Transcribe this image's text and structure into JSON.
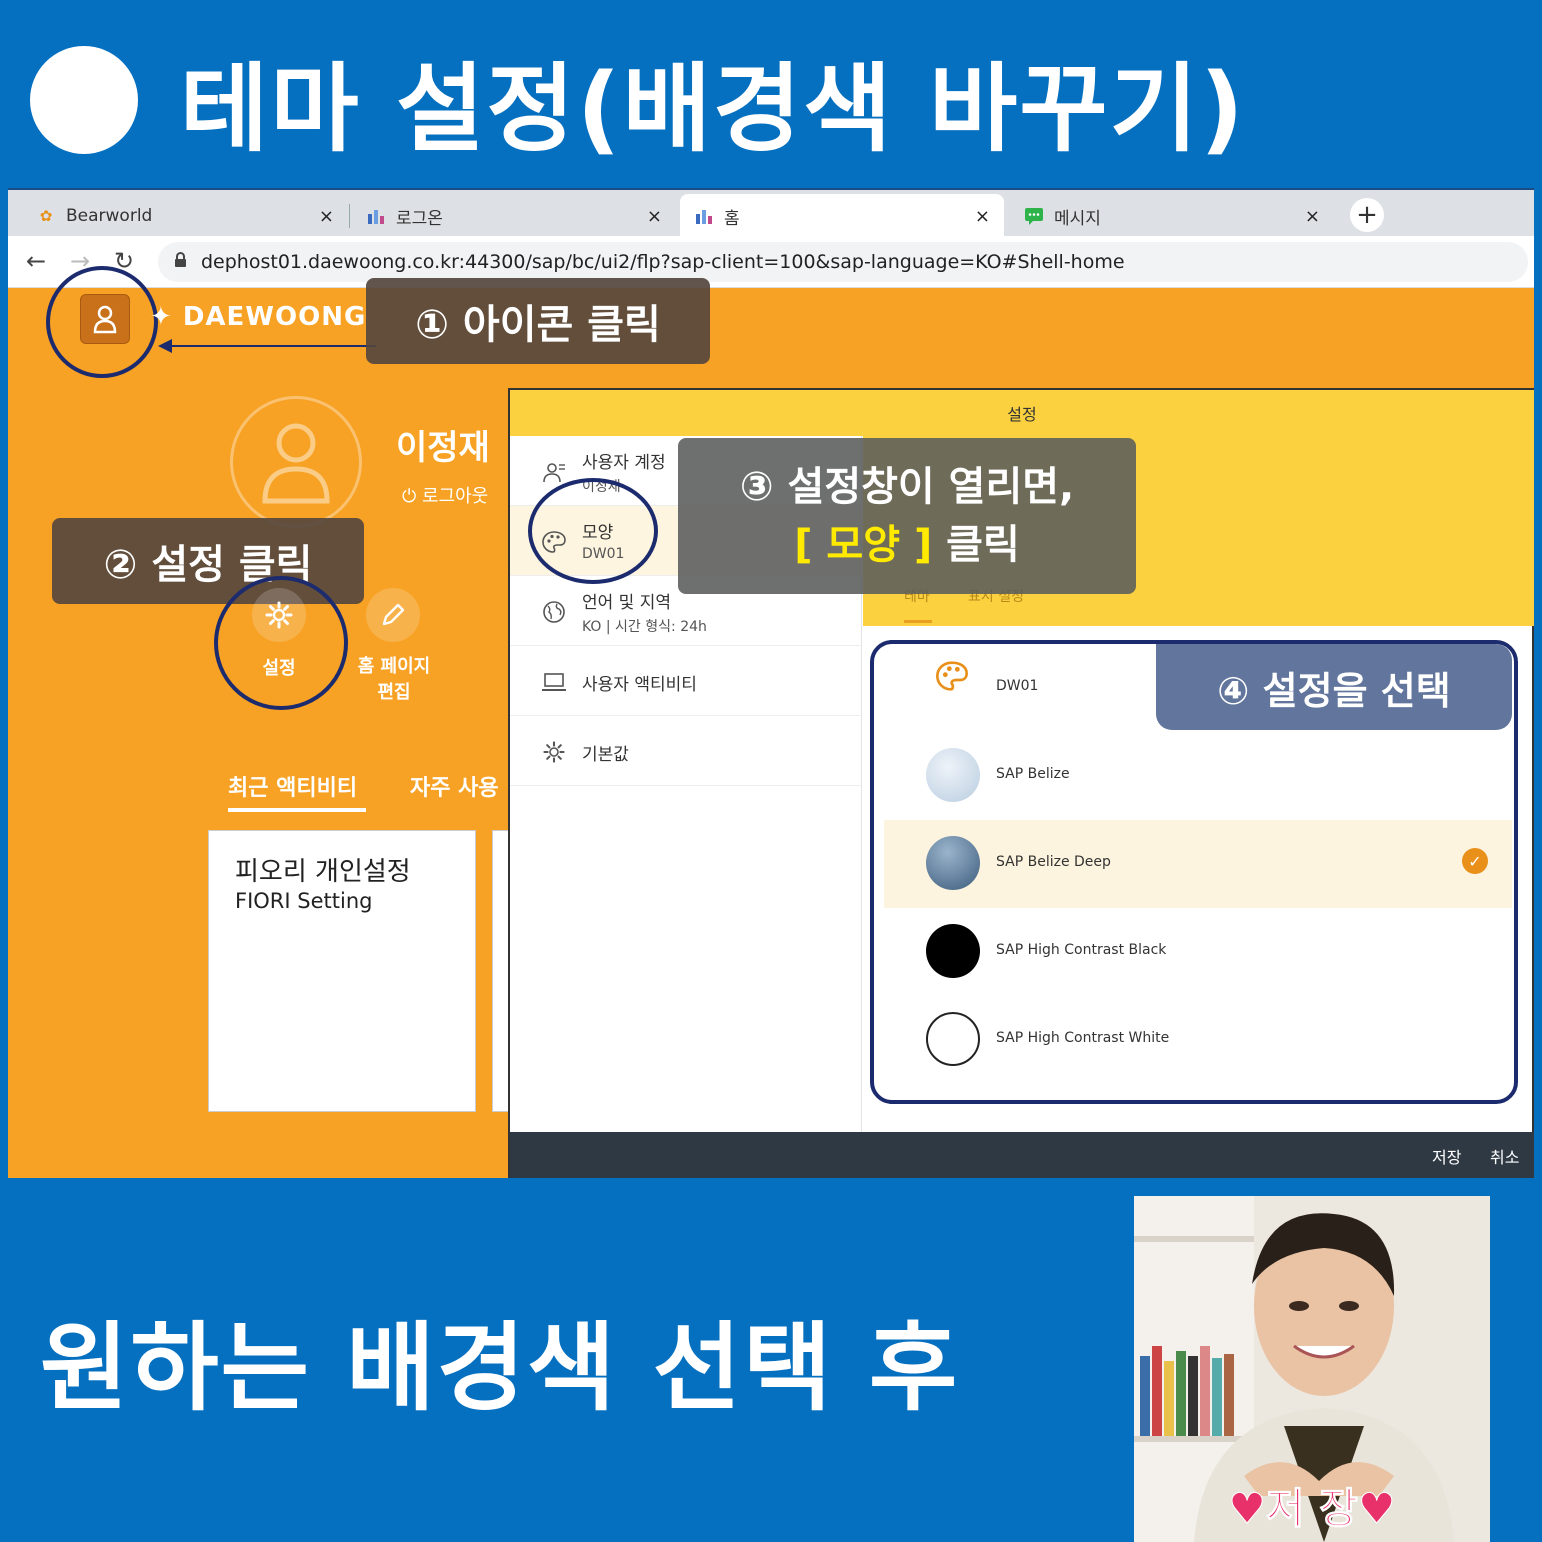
{
  "headline": "테마 설정(배경색 바꾸기)",
  "browser": {
    "tabs": [
      {
        "label": "Bearworld",
        "icon": "bear-favicon-icon"
      },
      {
        "label": "로그온",
        "icon": "sap-favicon-icon"
      },
      {
        "label": "홈",
        "icon": "sap-favicon-icon"
      },
      {
        "label": "메시지",
        "icon": "chat-favicon-icon"
      }
    ],
    "close_glyph": "×",
    "new_tab_glyph": "+",
    "url": "dephost01.daewoong.co.kr:44300/sap/bc/ui2/flp?sap-client=100&sap-language=KO#Shell-home"
  },
  "shell": {
    "logo": "DAEWOONG",
    "user_name": "이정재",
    "logout": "로그아웃",
    "settings_label": "설정",
    "edit_home_label": "홈 페이지 편집",
    "recent_tab": "최근 액티비티",
    "frequent_tab": "자주 사용",
    "card": {
      "title": "피오리 개인설정",
      "subtitle": "FIORI Setting"
    }
  },
  "callouts": {
    "step1": "① 아이콘 클릭",
    "step2": "② 설정 클릭",
    "step3_line1": "③ 설정창이 열리면,",
    "step3_hl": "[ 모양 ]",
    "step3_tail": " 클릭",
    "step4": "④ 설정을 선택"
  },
  "dialog": {
    "title": "설정",
    "nav": [
      {
        "title": "사용자 계정",
        "sub": "이정재"
      },
      {
        "title": "모양",
        "sub": "DW01"
      },
      {
        "title": "언어 및 지역",
        "sub": "KO | 시간 형식: 24h"
      },
      {
        "title": "사용자 액티비티",
        "sub": ""
      },
      {
        "title": "기본값",
        "sub": ""
      }
    ],
    "subtabs": [
      "테마",
      "표시 설정"
    ],
    "themes": [
      {
        "name": "DW01",
        "color": "#e8901a"
      },
      {
        "name": "SAP Belize",
        "color": "#c9d9e8"
      },
      {
        "name": "SAP Belize Deep",
        "color": "#4c6e8e"
      },
      {
        "name": "SAP High Contrast Black",
        "color": "#000000"
      },
      {
        "name": "SAP High Contrast White",
        "color": "#ffffff"
      }
    ],
    "selected_theme": "SAP Belize Deep",
    "save": "저장",
    "cancel": "취소"
  },
  "bottom_text": "원하는 배경색 선택 후",
  "photo_caption": "♥저 장♥",
  "colors": {
    "background": "#0670c0",
    "shell": "#f7a224",
    "dialog_header": "#fbd13f",
    "ring": "#1c2b6e"
  }
}
